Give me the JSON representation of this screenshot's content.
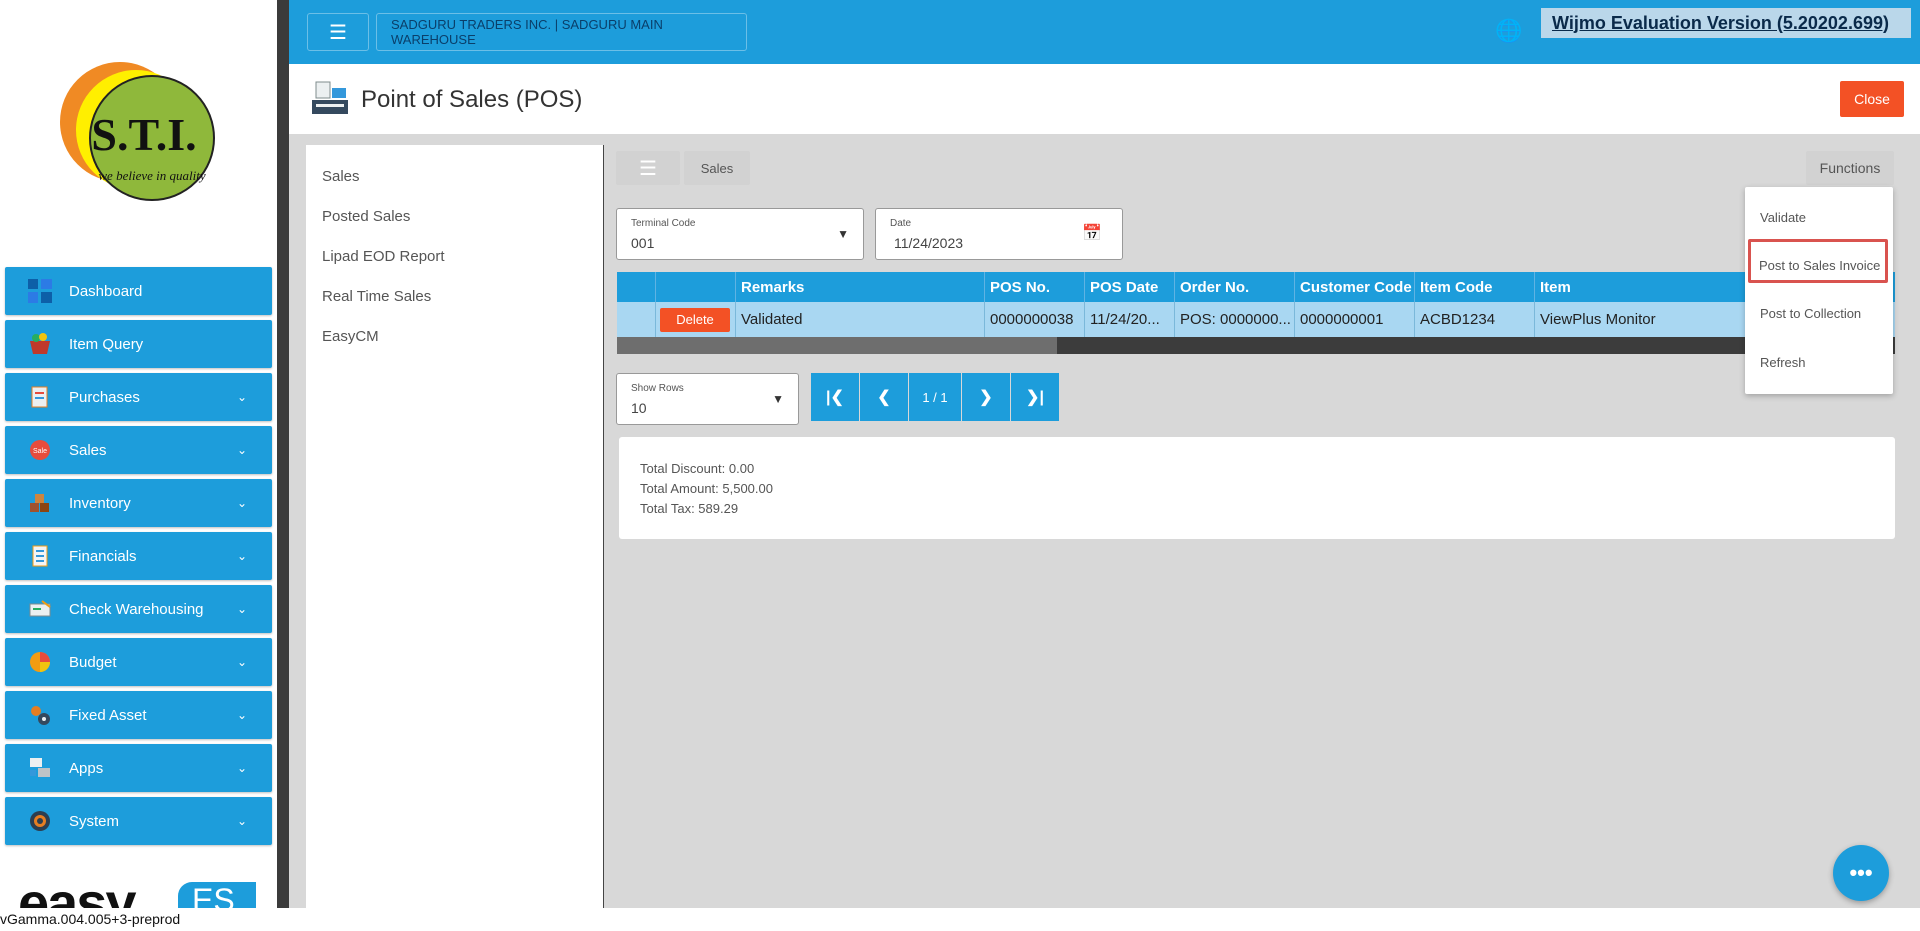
{
  "header": {
    "company": "SADGURU TRADERS INC. | SADGURU MAIN WAREHOUSE",
    "wijmo_notice": "Wijmo Evaluation Version (5.20202.699)"
  },
  "logo": {
    "initials": "S.T.I.",
    "tagline": "we believe in quality"
  },
  "sidebar": {
    "items": [
      {
        "label": "Dashboard",
        "icon": "dashboard-icon",
        "expandable": false
      },
      {
        "label": "Item Query",
        "icon": "basket-icon",
        "expandable": false
      },
      {
        "label": "Purchases",
        "icon": "clipboard-icon",
        "expandable": true
      },
      {
        "label": "Sales",
        "icon": "sale-tag-icon",
        "expandable": true
      },
      {
        "label": "Inventory",
        "icon": "boxes-icon",
        "expandable": true
      },
      {
        "label": "Financials",
        "icon": "ledger-icon",
        "expandable": true
      },
      {
        "label": "Check Warehousing",
        "icon": "check-icon",
        "expandable": true
      },
      {
        "label": "Budget",
        "icon": "pie-icon",
        "expandable": true
      },
      {
        "label": "Fixed Asset",
        "icon": "gears-icon",
        "expandable": true
      },
      {
        "label": "Apps",
        "icon": "apps-icon",
        "expandable": true
      },
      {
        "label": "System",
        "icon": "settings-icon",
        "expandable": true
      }
    ],
    "brand": "easy",
    "brand_suffix": "ES"
  },
  "page": {
    "title": "Point of Sales (POS)",
    "close_label": "Close"
  },
  "submenu": [
    "Sales",
    "Posted Sales",
    "Lipad EOD Report",
    "Real Time Sales",
    "EasyCM"
  ],
  "toolbar": {
    "breadcrumb": "Sales",
    "functions_label": "Functions"
  },
  "filters": {
    "terminal_label": "Terminal Code",
    "terminal_value": "001",
    "date_label": "Date",
    "date_value": "11/24/2023"
  },
  "grid": {
    "columns": [
      "",
      "",
      "Remarks",
      "POS No.",
      "POS Date",
      "Order No.",
      "Customer Code",
      "Item Code",
      "Item"
    ],
    "rows": [
      {
        "action": "Delete",
        "remarks": "Validated",
        "pos_no": "0000000038",
        "pos_date": "11/24/20...",
        "order_no": "POS: 0000000...",
        "customer_code": "0000000001",
        "item_code": "ACBD1234",
        "item": "ViewPlus Monitor"
      }
    ]
  },
  "pager": {
    "show_rows_label": "Show Rows",
    "show_rows_value": "10",
    "page_text": "1 / 1"
  },
  "totals": {
    "discount": "Total Discount: 0.00",
    "amount": "Total Amount: 5,500.00",
    "tax": "Total Tax: 589.29"
  },
  "functions_menu": [
    "Validate",
    "Post to Sales Invoice",
    "Post to Collection",
    "Refresh"
  ],
  "version": "vGamma.004.005+3-preprod",
  "colors": {
    "primary": "#1d9ddb",
    "danger": "#f35125",
    "highlight": "#d9534f"
  }
}
